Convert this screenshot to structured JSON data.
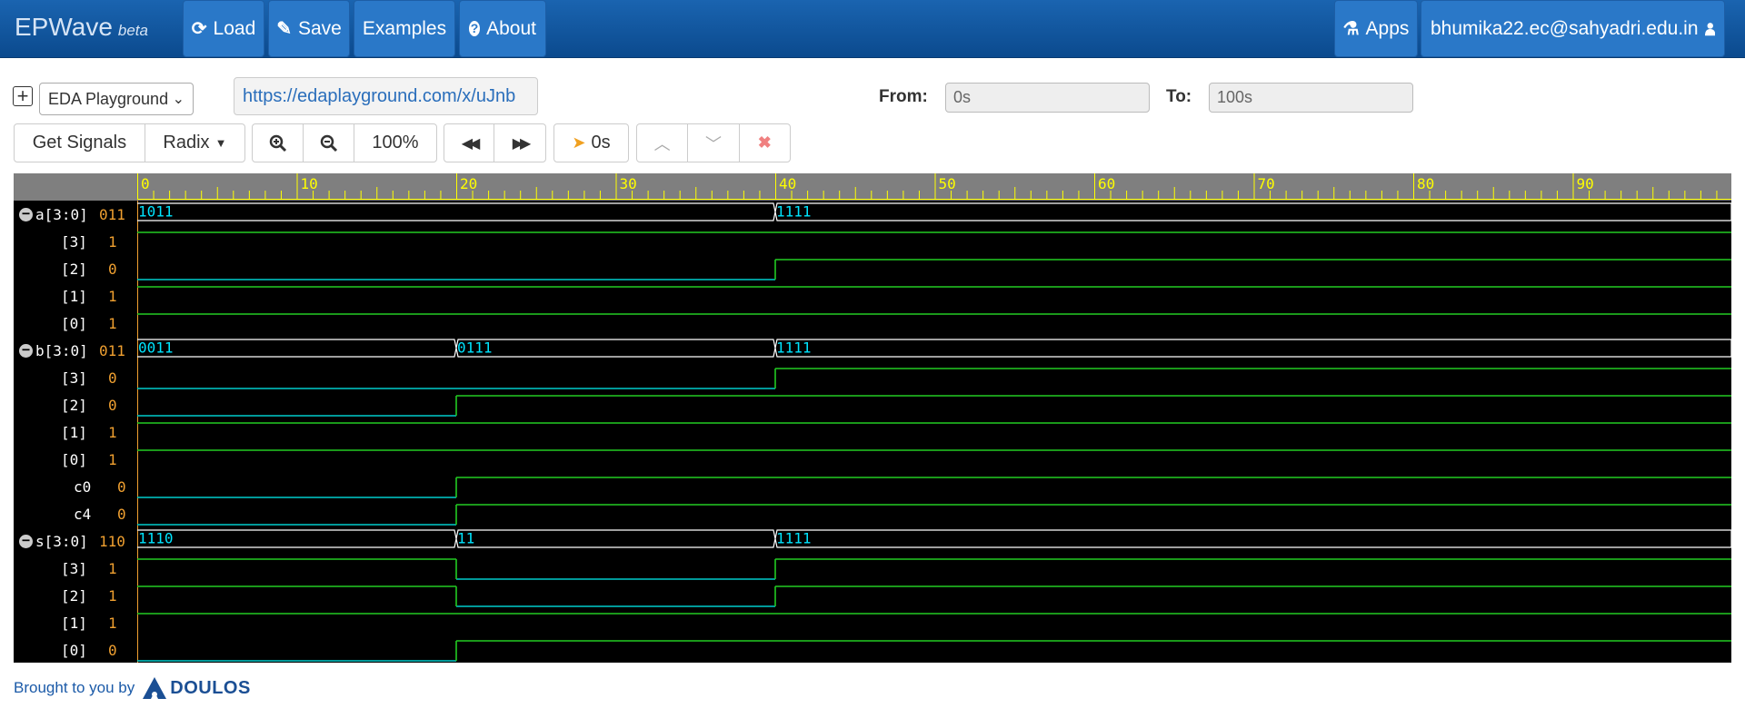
{
  "navbar": {
    "brand": "EPWave",
    "brand_suffix": "beta",
    "load_label": "Load",
    "save_label": "Save",
    "examples_label": "Examples",
    "about_label": "About",
    "apps_label": "Apps",
    "user_label": "bhumika22.ec@sahyadri.edu.in"
  },
  "toolbar": {
    "source_select": "EDA Playground",
    "url": "https://edaplayground.com/x/uJnb",
    "from_label": "From:",
    "from_value": "0s",
    "to_label": "To:",
    "to_value": "100s",
    "get_signals_label": "Get Signals",
    "radix_label": "Radix",
    "zoom_level": "100%",
    "cursor_time": "0s"
  },
  "colors": {
    "navbar": "#0f55a0",
    "wave_bg": "#000000",
    "ruler_bg": "#7f7f7f",
    "ruler_text": "#ffff00",
    "high": "#22cc22",
    "low": "#00cccc",
    "bus_value": "#00e5ff",
    "signal_value": "#f0a030"
  },
  "ruler": {
    "ticks": [
      "0",
      "10",
      "20",
      "30",
      "40",
      "50",
      "60",
      "70",
      "80",
      "90"
    ]
  },
  "signals": [
    {
      "name": "a[3:0]",
      "value": "011",
      "bus": true,
      "segments": [
        {
          "t": 0,
          "v": "1011"
        },
        {
          "t": 40,
          "v": "1111"
        }
      ]
    },
    {
      "name": "[3]",
      "value": "1",
      "transitions": [
        [
          0,
          1
        ]
      ]
    },
    {
      "name": "[2]",
      "value": "0",
      "transitions": [
        [
          0,
          0
        ],
        [
          40,
          1
        ]
      ]
    },
    {
      "name": "[1]",
      "value": "1",
      "transitions": [
        [
          0,
          1
        ]
      ]
    },
    {
      "name": "[0]",
      "value": "1",
      "transitions": [
        [
          0,
          1
        ]
      ]
    },
    {
      "name": "b[3:0]",
      "value": "011",
      "bus": true,
      "segments": [
        {
          "t": 0,
          "v": "0011"
        },
        {
          "t": 20,
          "v": "0111"
        },
        {
          "t": 40,
          "v": "1111"
        }
      ]
    },
    {
      "name": "[3]",
      "value": "0",
      "transitions": [
        [
          0,
          0
        ],
        [
          40,
          1
        ]
      ]
    },
    {
      "name": "[2]",
      "value": "0",
      "transitions": [
        [
          0,
          0
        ],
        [
          20,
          1
        ]
      ]
    },
    {
      "name": "[1]",
      "value": "1",
      "transitions": [
        [
          0,
          1
        ]
      ]
    },
    {
      "name": "[0]",
      "value": "1",
      "transitions": [
        [
          0,
          1
        ]
      ]
    },
    {
      "name": "c0",
      "value": "0",
      "transitions": [
        [
          0,
          0
        ],
        [
          20,
          1
        ]
      ]
    },
    {
      "name": "c4",
      "value": "0",
      "transitions": [
        [
          0,
          0
        ],
        [
          20,
          1
        ]
      ]
    },
    {
      "name": "s[3:0]",
      "value": "110",
      "bus": true,
      "segments": [
        {
          "t": 0,
          "v": "1110"
        },
        {
          "t": 20,
          "v": "11"
        },
        {
          "t": 40,
          "v": "1111"
        }
      ]
    },
    {
      "name": "[3]",
      "value": "1",
      "transitions": [
        [
          0,
          1
        ],
        [
          20,
          0
        ],
        [
          40,
          1
        ]
      ]
    },
    {
      "name": "[2]",
      "value": "1",
      "transitions": [
        [
          0,
          1
        ],
        [
          20,
          0
        ],
        [
          40,
          1
        ]
      ]
    },
    {
      "name": "[1]",
      "value": "1",
      "transitions": [
        [
          0,
          1
        ]
      ]
    },
    {
      "name": "[0]",
      "value": "0",
      "transitions": [
        [
          0,
          0
        ],
        [
          20,
          1
        ]
      ]
    }
  ],
  "footer": {
    "text": "Brought to you by",
    "logo_text": "DOULOS"
  }
}
